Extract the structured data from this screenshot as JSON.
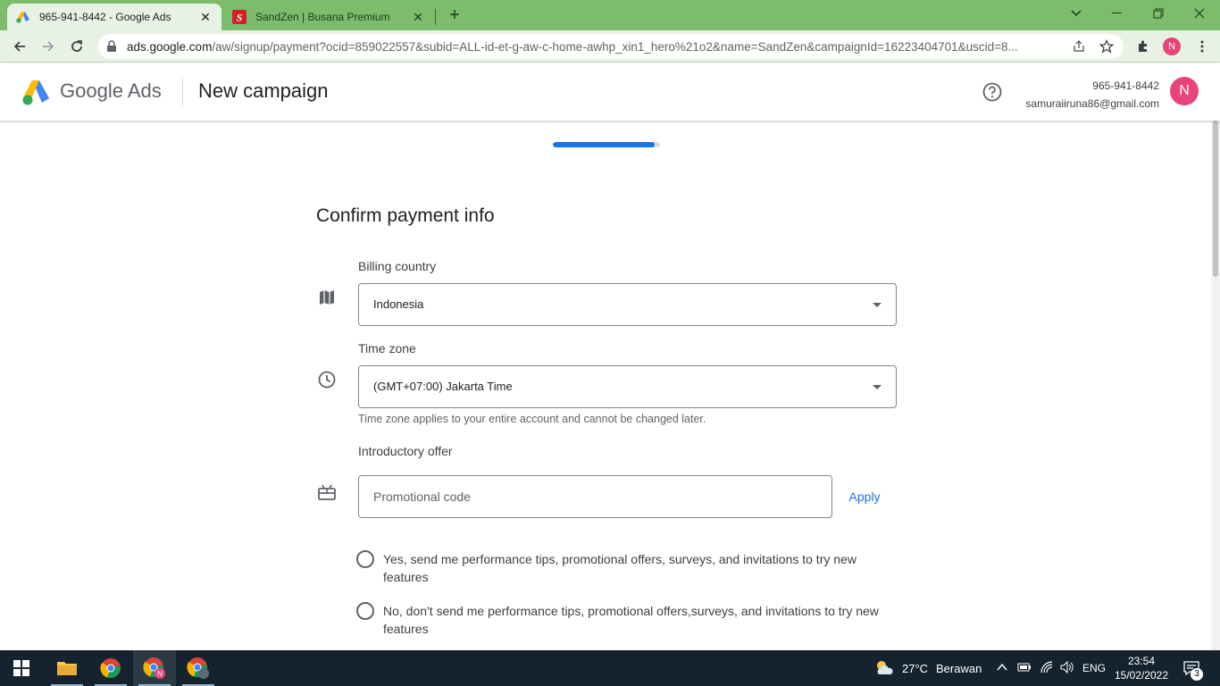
{
  "browser": {
    "tabs": [
      {
        "title": "965-941-8442 - Google Ads",
        "active": true,
        "favicon": "google-ads-icon"
      },
      {
        "title": "SandZen | Busana Premium",
        "active": false,
        "favicon": "sandzen-icon"
      }
    ],
    "url_host": "ads.google.com",
    "url_path": "/aw/signup/payment?ocid=859022557&subid=ALL-id-et-g-aw-c-home-awhp_xin1_hero%21o2&name=SandZen&campaignId=16223404701&uscid=8...",
    "profile_initial": "N"
  },
  "header": {
    "brand_google": "Google",
    "brand_ads": "Ads",
    "title": "New campaign",
    "account_id": "965-941-8442",
    "account_email": "samuraiiruna86@gmail.com",
    "avatar_initial": "N"
  },
  "progress": {
    "fraction": 0.95
  },
  "form": {
    "section_title": "Confirm payment info",
    "billing_country_label": "Billing country",
    "billing_country_value": "Indonesia",
    "time_zone_label": "Time zone",
    "time_zone_value": "(GMT+07:00) Jakarta Time",
    "time_zone_hint": "Time zone applies to your entire account and cannot be changed later.",
    "intro_offer_label": "Introductory offer",
    "promo_placeholder": "Promotional code",
    "apply_label": "Apply",
    "opt_in_yes": "Yes, send me performance tips, promotional offers, surveys, and invitations to try new features",
    "opt_in_no": "No, don't send me performance tips, promotional offers,surveys, and invitations to try new features"
  },
  "taskbar": {
    "weather_temp": "27°C",
    "weather_desc": "Berawan",
    "language": "ENG",
    "time": "23:54",
    "date": "15/02/2022",
    "notification_count": "3"
  },
  "colors": {
    "accent": "#1a73e8",
    "tab_strip": "#7cbc6c",
    "avatar": "#e8437a"
  }
}
